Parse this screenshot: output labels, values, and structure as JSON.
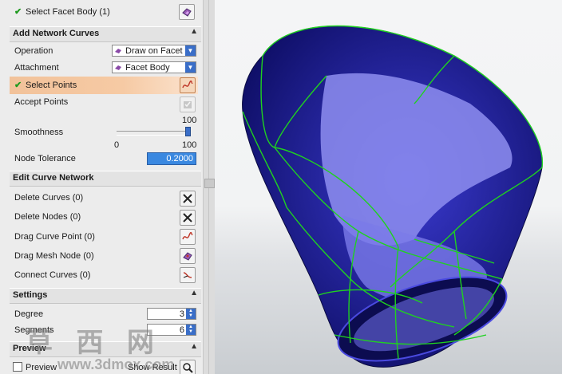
{
  "panel": {
    "select_facet_body": "Select Facet Body (1)",
    "add_network_curves": {
      "title": "Add Network Curves",
      "operation_label": "Operation",
      "operation_value": "Draw on Facet",
      "attachment_label": "Attachment",
      "attachment_value": "Facet Body",
      "select_points": "Select Points",
      "accept_points": "Accept Points",
      "smoothness_label": "Smoothness",
      "smoothness_value": "100",
      "smoothness_min": "0",
      "smoothness_max": "100",
      "smoothness_level": 1.0,
      "node_tolerance_label": "Node Tolerance",
      "node_tolerance_value": "0.2000"
    },
    "edit_curve_network": {
      "title": "Edit Curve Network",
      "delete_curves": "Delete Curves (0)",
      "delete_nodes": "Delete Nodes (0)",
      "drag_curve_point": "Drag Curve Point (0)",
      "drag_mesh_node": "Drag Mesh Node (0)",
      "connect_curves": "Connect Curves (0)"
    },
    "settings": {
      "title": "Settings",
      "degree_label": "Degree",
      "degree_value": "3",
      "segments_label": "Segments",
      "segments_value": "6"
    },
    "preview": {
      "title": "Preview",
      "preview_checkbox": "Preview",
      "show_result": "Show Result"
    }
  },
  "watermark": {
    "chars": "草 西 网",
    "url": "www.3dmox.com"
  },
  "colors": {
    "check": "#1e9a1e",
    "accent": "#3a6ec8",
    "highlight": "#f4c49e",
    "mesh": "#20208a",
    "curves": "#1fd21f"
  }
}
